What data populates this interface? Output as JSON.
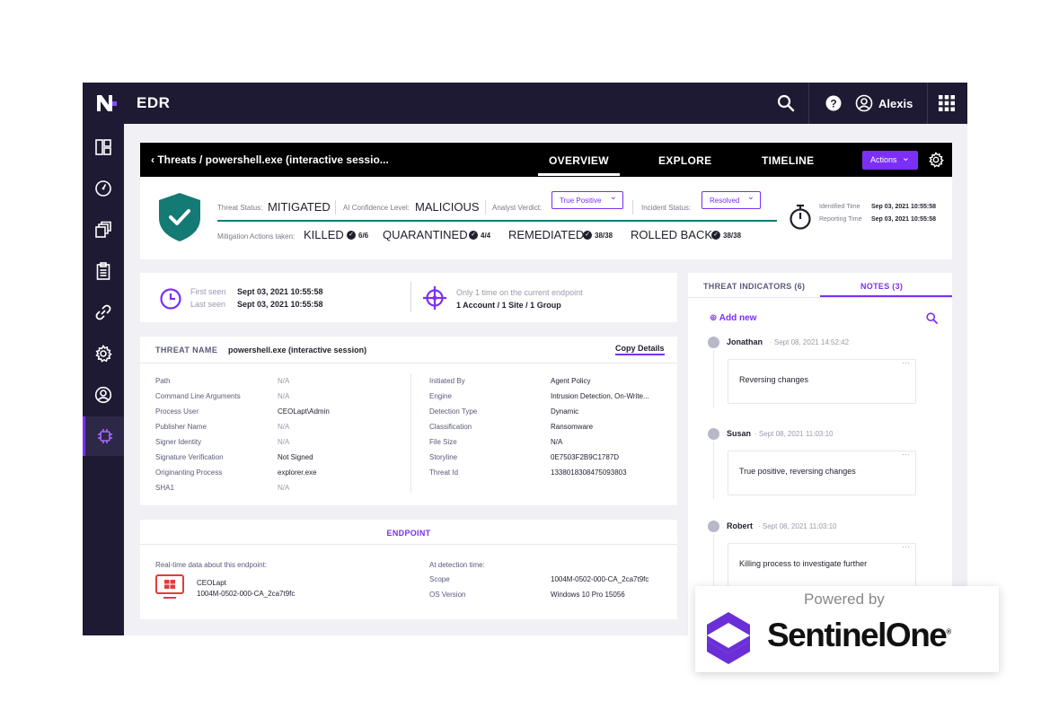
{
  "app": {
    "title": "EDR",
    "user": "Alexis"
  },
  "sidebar": {
    "items": [
      {
        "name": "dashboard-icon"
      },
      {
        "name": "gauge-icon"
      },
      {
        "name": "stack-icon"
      },
      {
        "name": "clipboard-icon"
      },
      {
        "name": "link-icon"
      },
      {
        "name": "gear-icon"
      },
      {
        "name": "user-icon"
      },
      {
        "name": "chip-icon",
        "active": true
      }
    ]
  },
  "header": {
    "breadcrumb": "‹  Threats / powershell.exe (interactive sessio...",
    "tabs": [
      {
        "label": "OVERVIEW",
        "active": true
      },
      {
        "label": "EXPLORE",
        "active": false
      },
      {
        "label": "TIMELINE",
        "active": false
      }
    ],
    "actions_label": "Actions"
  },
  "status": {
    "threat_status_label": "Threat Status:",
    "threat_status_value": "MITIGATED",
    "ai_confidence_label": "AI Confidence Level:",
    "ai_confidence_value": "MALICIOUS",
    "analyst_verdict_label": "Analyst Verdict:",
    "analyst_verdict_value": "True Positive",
    "incident_status_label": "Incident Status:",
    "incident_status_value": "Resolved",
    "mitigation_label": "Mitigation Actions taken:",
    "mitigation": [
      {
        "action": "KILLED",
        "count": "6/6"
      },
      {
        "action": "QUARANTINED",
        "count": "4/4"
      },
      {
        "action": "REMEDIATED",
        "count": "38/38"
      },
      {
        "action": "ROLLED BACK",
        "count": "38/38"
      }
    ],
    "identified_label": "Identified Time",
    "identified_value": "Sep 03, 2021 10:55:58",
    "reporting_label": "Reporting Time",
    "reporting_value": "Sep 03, 2021 10:55:58"
  },
  "seen": {
    "first_label": "First seen",
    "first_value": "Sept 03, 2021 10:55:58",
    "last_label": "Last seen",
    "last_value": "Sept 03, 2021 10:55:58",
    "occurrence": "Only 1 time on the current endpoint",
    "scope": "1 Account / 1 Site / 1 Group"
  },
  "threat": {
    "name_label": "THREAT NAME",
    "name_value": "powershell.exe (interactive session)",
    "copy_label": "Copy Details",
    "left": [
      {
        "label": "Path",
        "value": "N/A"
      },
      {
        "label": "Command Line Arguments",
        "value": "N/A"
      },
      {
        "label": "Process User",
        "value": "CEOLapt\\Admin"
      },
      {
        "label": "Publisher Name",
        "value": "N/A"
      },
      {
        "label": "Signer Identity",
        "value": "N/A"
      },
      {
        "label": "Signature Verification",
        "value": "Not Signed"
      },
      {
        "label": "Originanting Process",
        "value": "explorer.exe"
      },
      {
        "label": "SHA1",
        "value": "N/A"
      }
    ],
    "right": [
      {
        "label": "Initiated By",
        "value": "Agent Policy"
      },
      {
        "label": "Engine",
        "value": "Intrusion Detection, On-Write..."
      },
      {
        "label": "Detection Type",
        "value": "Dynamic"
      },
      {
        "label": "Classification",
        "value": "Ransomware"
      },
      {
        "label": "File Size",
        "value": "N/A"
      },
      {
        "label": "Storyline",
        "value": "0E7503F2B9C1787D"
      },
      {
        "label": "Threat Id",
        "value": "1338018308475093803"
      }
    ]
  },
  "endpoint": {
    "title": "ENDPOINT",
    "realtime_label": "Real-time data about this endpoint:",
    "name": "CEOLapt",
    "id": "1004M-0502-000-CA_2ca7t9fc",
    "detection_label": "At detection time:",
    "scope_label": "Scope",
    "scope_value": "1004M-0502-000-CA_2ca7t9fc",
    "os_label": "OS Version",
    "os_value": "Windows 10 Pro 15056"
  },
  "notes_panel": {
    "tabs": [
      {
        "label": "THREAT INDICATORS (6)",
        "active": false
      },
      {
        "label": "NOTES (3)",
        "active": true
      }
    ],
    "add_new": "Add new",
    "notes": [
      {
        "author": "Jonathan",
        "time": "Sept 08, 2021 14:52:42",
        "text": "Reversing changes"
      },
      {
        "author": "Susan",
        "time": "Sept 08, 2021 11:03:10",
        "text": "True positive, reversing changes"
      },
      {
        "author": "Robert",
        "time": "Sept 08, 2021 11:03:10",
        "text": "Killing process to investigate further"
      }
    ]
  },
  "powered_by": {
    "label": "Powered by",
    "brand": "SentinelOne",
    "trademark": "®"
  },
  "colors": {
    "accent": "#7b2ff7",
    "nav": "#1e1a33",
    "shield": "#137a74"
  }
}
